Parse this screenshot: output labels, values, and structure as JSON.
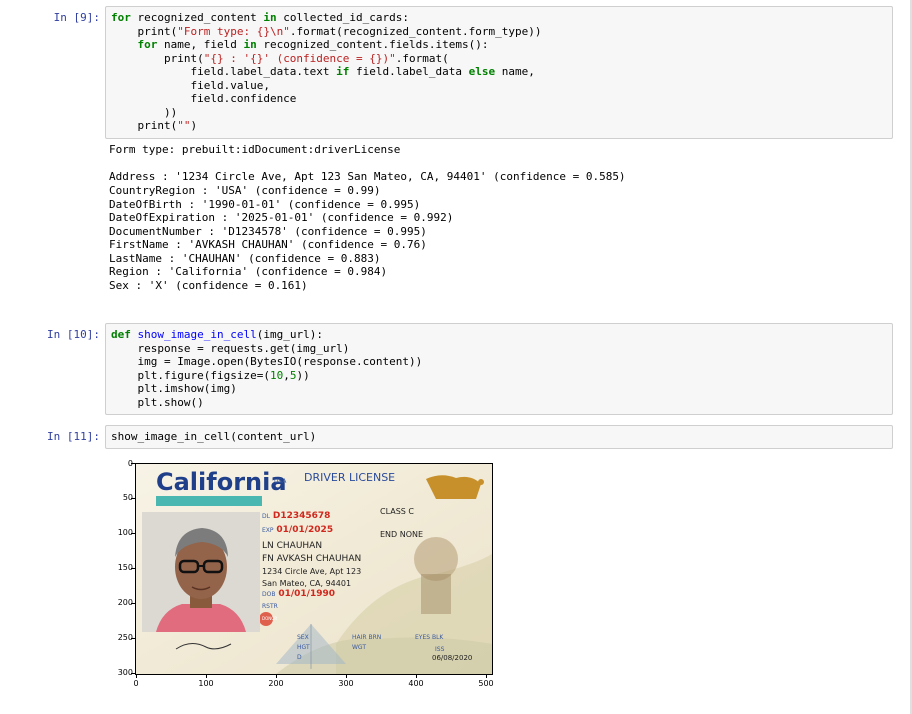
{
  "cells": {
    "c9": {
      "prompt": "In [9]:",
      "lines": {
        "l1a": "for",
        "l1b": " recognized_content ",
        "l1c": "in",
        "l1d": " collected_id_cards:",
        "l2a": "    print(",
        "l2b": "\"Form type: {}\\n\"",
        "l2c": ".format(recognized_content.form_type))",
        "l3a": "    ",
        "l3b": "for",
        "l3c": " name, field ",
        "l3d": "in",
        "l3e": " recognized_content.fields.items():",
        "l4a": "        print(",
        "l4b": "\"{} : '{}' (confidence = {})\"",
        "l4c": ".format(",
        "l5a": "            field.label_data.text ",
        "l5b": "if",
        "l5c": " field.label_data ",
        "l5d": "else",
        "l5e": " name,",
        "l6": "            field.value,",
        "l7": "            field.confidence",
        "l8": "        ))",
        "l9a": "    print(",
        "l9b": "\"\"",
        "l9c": ")"
      }
    },
    "out9": [
      "Form type: prebuilt:idDocument:driverLicense",
      "",
      "Address : '1234 Circle Ave, Apt 123 San Mateo, CA, 94401' (confidence = 0.585)",
      "CountryRegion : 'USA' (confidence = 0.99)",
      "DateOfBirth : '1990-01-01' (confidence = 0.995)",
      "DateOfExpiration : '2025-01-01' (confidence = 0.992)",
      "DocumentNumber : 'D1234578' (confidence = 0.995)",
      "FirstName : 'AVKASH CHAUHAN' (confidence = 0.76)",
      "LastName : 'CHAUHAN' (confidence = 0.883)",
      "Region : 'California' (confidence = 0.984)",
      "Sex : 'X' (confidence = 0.161)"
    ],
    "c10": {
      "prompt": "In [10]:",
      "l1a": "def",
      "l1b": " show_image_in_cell",
      "l1c": "(img_url):",
      "l2": "    response = requests.get(img_url)",
      "l3": "    img = Image.open(BytesIO(response.content))",
      "l4a": "    plt.figure(figsize=(",
      "l4b": "10",
      "l4c": ",",
      "l4d": "5",
      "l4e": "))",
      "l5": "    plt.imshow(img)",
      "l6": "    plt.show()"
    },
    "c11": {
      "prompt": "In [11]:",
      "code": "show_image_in_cell(content_url)"
    }
  },
  "figure": {
    "yticks": [
      "0",
      "50",
      "100",
      "150",
      "200",
      "250",
      "300"
    ],
    "xticks": [
      "0",
      "100",
      "200",
      "300",
      "400",
      "500"
    ],
    "license": {
      "state": "California",
      "usa": "USA",
      "title": "DRIVER LICENSE",
      "dl_label": "DL",
      "dl_value": "D12345678",
      "class": "CLASS C",
      "exp_label": "EXP",
      "exp_value": "01/01/2025",
      "end": "END NONE",
      "ln": "LN CHAUHAN",
      "fn": "FN AVKASH CHAUHAN",
      "addr1": "1234 Circle Ave, Apt 123",
      "addr2": "San Mateo, CA, 94401",
      "dob_label": "DOB",
      "dob_value": "01/01/1990",
      "rstr": "RSTR",
      "sex": "SEX",
      "hgt": "HGT",
      "d": "D",
      "hair": "HAIR BRN",
      "wgt": "WGT",
      "eyes": "EYES BLK",
      "iss": "ISS",
      "iss_date": "06/08/2020",
      "donor": "DONOR"
    }
  },
  "colors": {
    "prompt": "#303f9f",
    "keyword": "#008000",
    "string": "#ba2121",
    "operator": "#aa22ff"
  }
}
